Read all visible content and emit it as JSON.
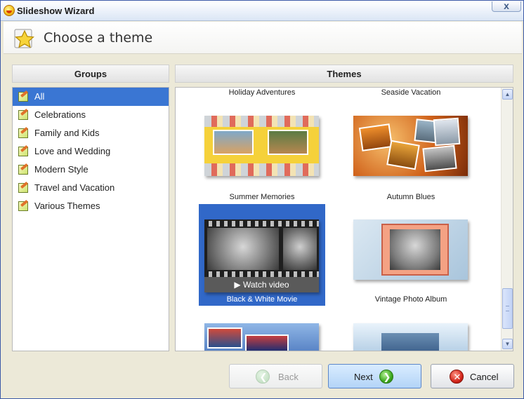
{
  "window": {
    "title": "Slideshow Wizard",
    "close_label": "x"
  },
  "header": {
    "title": "Choose a theme",
    "icon": "star-icon"
  },
  "groups": {
    "heading": "Groups",
    "items": [
      {
        "label": "All",
        "selected": true
      },
      {
        "label": "Celebrations"
      },
      {
        "label": "Family and Kids"
      },
      {
        "label": "Love and Wedding"
      },
      {
        "label": "Modern Style"
      },
      {
        "label": "Travel and Vacation"
      },
      {
        "label": "Various Themes"
      }
    ]
  },
  "themes": {
    "heading": "Themes",
    "top_labels": [
      "Holiday Adventures",
      "Seaside Vacation"
    ],
    "tiles": [
      {
        "name": "Summer Memories"
      },
      {
        "name": "Autumn Blues"
      },
      {
        "name": "Black & White Movie",
        "selected": true,
        "overlay": "Watch video"
      },
      {
        "name": "Vintage Photo Album"
      }
    ]
  },
  "buttons": {
    "back": "Back",
    "next": "Next",
    "cancel": "Cancel"
  },
  "colors": {
    "selection": "#3a76d3",
    "tile_selection": "#3168c8",
    "title_border": "#3c5aa8"
  }
}
